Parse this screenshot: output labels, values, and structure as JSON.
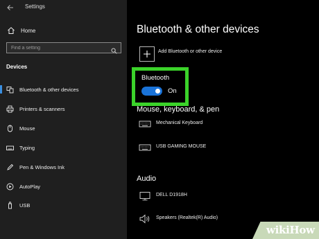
{
  "window": {
    "title": "Settings"
  },
  "sidebar": {
    "home_label": "Home",
    "search_placeholder": "Find a setting",
    "section_label": "Devices",
    "items": [
      {
        "label": "Bluetooth & other devices",
        "icon": "bluetooth-devices-icon",
        "active": true
      },
      {
        "label": "Printers & scanners",
        "icon": "printer-icon",
        "active": false
      },
      {
        "label": "Mouse",
        "icon": "mouse-icon",
        "active": false
      },
      {
        "label": "Typing",
        "icon": "keyboard-icon",
        "active": false
      },
      {
        "label": "Pen & Windows Ink",
        "icon": "pen-icon",
        "active": false
      },
      {
        "label": "AutoPlay",
        "icon": "autoplay-icon",
        "active": false
      },
      {
        "label": "USB",
        "icon": "usb-icon",
        "active": false
      }
    ]
  },
  "main": {
    "title": "Bluetooth & other devices",
    "add_device_label": "Add Bluetooth or other device",
    "bluetooth": {
      "label": "Bluetooth",
      "state": "On",
      "on": true
    },
    "groups": {
      "mouse_keyboard_pen": {
        "title": "Mouse, keyboard, & pen",
        "devices": [
          "Mechanical Keyboard",
          "USB GAMING MOUSE"
        ]
      },
      "audio": {
        "title": "Audio",
        "devices": [
          "DELL D1918H",
          "Speakers (Realtek(R) Audio)"
        ]
      }
    }
  },
  "watermark": {
    "text_prefix": "wiki",
    "text_suffix": "How"
  },
  "colors": {
    "sidebar_bg": "#1f1f1f",
    "main_bg": "#000000",
    "accent": "#1a73d8",
    "highlight": "#3bd32a"
  }
}
